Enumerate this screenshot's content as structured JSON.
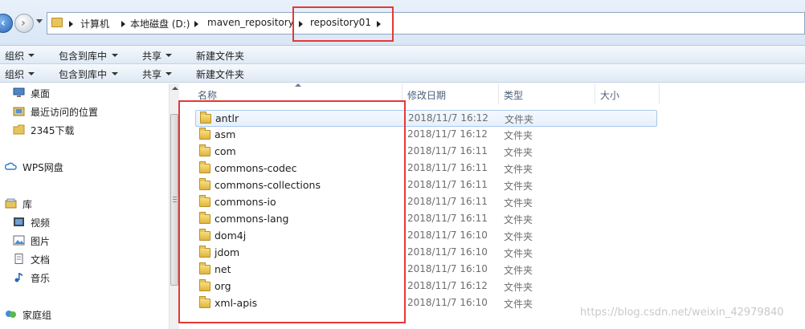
{
  "address_bar": {
    "crumbs": [
      "计算机",
      "本地磁盘 (D:)",
      "maven_repository",
      "repository01"
    ]
  },
  "toolbars": [
    {
      "items": [
        "组织",
        "包含到库中",
        "共享",
        "新建文件夹"
      ]
    },
    {
      "items": [
        "组织",
        "包含到库中",
        "共享",
        "新建文件夹"
      ]
    }
  ],
  "nav_pane": {
    "items": [
      {
        "label": "桌面",
        "icon": "desktop-icon"
      },
      {
        "label": "最近访问的位置",
        "icon": "recent-places-icon"
      },
      {
        "label": "2345下载",
        "icon": "folder-icon"
      },
      {
        "label": "WPS网盘",
        "icon": "cloud-icon"
      },
      {
        "label": "库",
        "icon": "library-icon"
      },
      {
        "label": "视频",
        "icon": "video-icon"
      },
      {
        "label": "图片",
        "icon": "pictures-icon"
      },
      {
        "label": "文档",
        "icon": "documents-icon"
      },
      {
        "label": "音乐",
        "icon": "music-icon"
      },
      {
        "label": "家庭组",
        "icon": "homegroup-icon"
      }
    ]
  },
  "file_list": {
    "columns": [
      "名称",
      "修改日期",
      "类型",
      "大小"
    ],
    "rows": [
      {
        "name": "antlr",
        "date": "2018/11/7 16:12",
        "type": "文件夹"
      },
      {
        "name": "asm",
        "date": "2018/11/7 16:12",
        "type": "文件夹"
      },
      {
        "name": "com",
        "date": "2018/11/7 16:11",
        "type": "文件夹"
      },
      {
        "name": "commons-codec",
        "date": "2018/11/7 16:11",
        "type": "文件夹"
      },
      {
        "name": "commons-collections",
        "date": "2018/11/7 16:11",
        "type": "文件夹"
      },
      {
        "name": "commons-io",
        "date": "2018/11/7 16:11",
        "type": "文件夹"
      },
      {
        "name": "commons-lang",
        "date": "2018/11/7 16:11",
        "type": "文件夹"
      },
      {
        "name": "dom4j",
        "date": "2018/11/7 16:10",
        "type": "文件夹"
      },
      {
        "name": "jdom",
        "date": "2018/11/7 16:10",
        "type": "文件夹"
      },
      {
        "name": "net",
        "date": "2018/11/7 16:10",
        "type": "文件夹"
      },
      {
        "name": "org",
        "date": "2018/11/7 16:12",
        "type": "文件夹"
      },
      {
        "name": "xml-apis",
        "date": "2018/11/7 16:10",
        "type": "文件夹"
      }
    ]
  },
  "watermark": "https://blog.csdn.net/weixin_42979840",
  "colors": {
    "highlight_box": "#e53935",
    "selection_border": "#a9c9ee",
    "folder_yellow": "#e0b53e"
  }
}
